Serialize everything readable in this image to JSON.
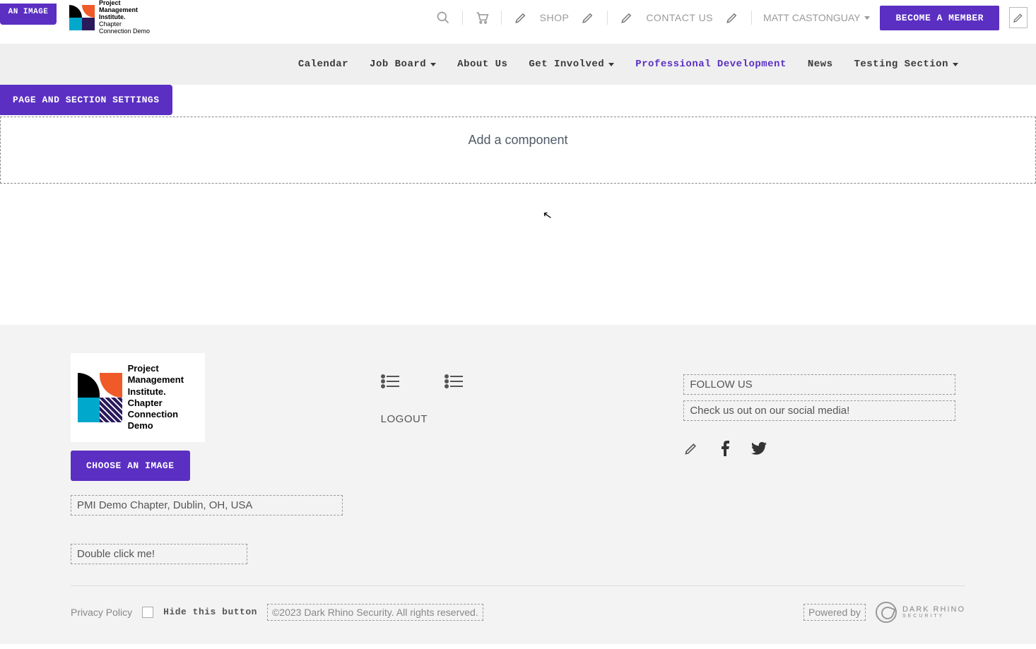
{
  "topbar": {
    "choose_image": "AN IMAGE",
    "logo_lines": [
      "Project",
      "Management",
      "Institute.",
      "Chapter",
      "Connection Demo"
    ],
    "shop": "SHOP",
    "contact": "CONTACT US",
    "user": "MATT CASTONGUAY",
    "member_btn": "BECOME A MEMBER"
  },
  "nav": {
    "items": [
      {
        "label": "Calendar",
        "dropdown": false
      },
      {
        "label": "Job Board",
        "dropdown": true
      },
      {
        "label": "About Us",
        "dropdown": false
      },
      {
        "label": "Get Involved",
        "dropdown": true
      },
      {
        "label": "Professional Development",
        "dropdown": false,
        "active": true
      },
      {
        "label": "News",
        "dropdown": false
      },
      {
        "label": "Testing Section",
        "dropdown": true
      }
    ]
  },
  "page_settings": "PAGE AND SECTION SETTINGS",
  "add_component": "Add a component",
  "footer": {
    "logo_lines": [
      "Project",
      "Management",
      "Institute.",
      "Chapter",
      "Connection Demo"
    ],
    "choose_image": "CHOOSE AN IMAGE",
    "address": "PMI Demo Chapter, Dublin, OH, USA",
    "double_click": "Double click me!",
    "logout": "LOGOUT",
    "follow_heading": "FOLLOW US",
    "follow_sub": "Check us out on our social media!",
    "privacy": "Privacy Policy",
    "hide_button": "Hide this button",
    "copyright": "©2023 Dark Rhino Security. All rights reserved.",
    "powered": "Powered by",
    "dr_name": "DARK RHINO",
    "dr_sub": "SECURITY"
  }
}
